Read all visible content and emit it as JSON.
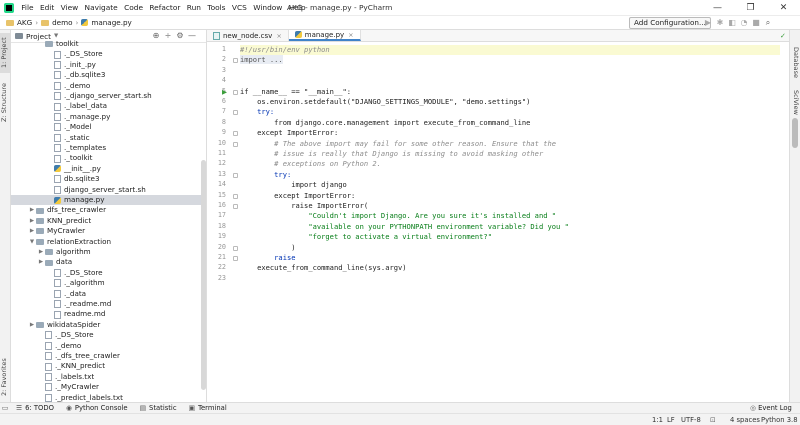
{
  "window": {
    "title": "AKG - manage.py - PyCharm",
    "menu": [
      "File",
      "Edit",
      "View",
      "Navigate",
      "Code",
      "Refactor",
      "Run",
      "Tools",
      "VCS",
      "Window",
      "Help"
    ],
    "controls": [
      "—",
      "❐",
      "✕"
    ]
  },
  "navbar": {
    "crumbs": [
      "AKG",
      "demo",
      "manage.py"
    ],
    "run_config_button": "Add Configuration..."
  },
  "left_tool_tabs": [
    "1: Project",
    "Z: Structure",
    "2: Favorites"
  ],
  "right_tool_tabs": [
    "Database",
    "SciView"
  ],
  "project": {
    "title": "Project",
    "tree": [
      {
        "label": "toolkit",
        "indent": 3,
        "kind": "folder",
        "arrow": ""
      },
      {
        "label": "._DS_Store",
        "indent": 4,
        "kind": "file",
        "arrow": ""
      },
      {
        "label": "._init_.py",
        "indent": 4,
        "kind": "file",
        "arrow": ""
      },
      {
        "label": "._db.sqlite3",
        "indent": 4,
        "kind": "file",
        "arrow": ""
      },
      {
        "label": "._demo",
        "indent": 4,
        "kind": "file",
        "arrow": ""
      },
      {
        "label": "._django_server_start.sh",
        "indent": 4,
        "kind": "file",
        "arrow": ""
      },
      {
        "label": "._label_data",
        "indent": 4,
        "kind": "file",
        "arrow": ""
      },
      {
        "label": "._manage.py",
        "indent": 4,
        "kind": "file",
        "arrow": ""
      },
      {
        "label": "._Model",
        "indent": 4,
        "kind": "file",
        "arrow": ""
      },
      {
        "label": "._static",
        "indent": 4,
        "kind": "file",
        "arrow": ""
      },
      {
        "label": "._templates",
        "indent": 4,
        "kind": "file",
        "arrow": ""
      },
      {
        "label": "._toolkit",
        "indent": 4,
        "kind": "file",
        "arrow": ""
      },
      {
        "label": "__init__.py",
        "indent": 4,
        "kind": "py",
        "arrow": ""
      },
      {
        "label": "db.sqlite3",
        "indent": 4,
        "kind": "file",
        "arrow": ""
      },
      {
        "label": "django_server_start.sh",
        "indent": 4,
        "kind": "file",
        "arrow": ""
      },
      {
        "label": "manage.py",
        "indent": 4,
        "kind": "py",
        "arrow": "",
        "selected": true
      },
      {
        "label": "dfs_tree_crawler",
        "indent": 2,
        "kind": "folder",
        "arrow": "▶"
      },
      {
        "label": "KNN_predict",
        "indent": 2,
        "kind": "folder",
        "arrow": "▶"
      },
      {
        "label": "MyCrawler",
        "indent": 2,
        "kind": "folder",
        "arrow": "▶"
      },
      {
        "label": "relationExtraction",
        "indent": 2,
        "kind": "folder",
        "arrow": "▼"
      },
      {
        "label": "algorithm",
        "indent": 3,
        "kind": "folder",
        "arrow": "▶"
      },
      {
        "label": "data",
        "indent": 3,
        "kind": "folder",
        "arrow": "▶"
      },
      {
        "label": "._DS_Store",
        "indent": 4,
        "kind": "file",
        "arrow": ""
      },
      {
        "label": "._algorithm",
        "indent": 4,
        "kind": "file",
        "arrow": ""
      },
      {
        "label": "._data",
        "indent": 4,
        "kind": "file",
        "arrow": ""
      },
      {
        "label": "._readme.md",
        "indent": 4,
        "kind": "file",
        "arrow": ""
      },
      {
        "label": "readme.md",
        "indent": 4,
        "kind": "file",
        "arrow": ""
      },
      {
        "label": "wikidataSpider",
        "indent": 2,
        "kind": "folder",
        "arrow": "▶"
      },
      {
        "label": "._DS_Store",
        "indent": 3,
        "kind": "file",
        "arrow": ""
      },
      {
        "label": "._demo",
        "indent": 3,
        "kind": "file",
        "arrow": ""
      },
      {
        "label": "._dfs_tree_crawler",
        "indent": 3,
        "kind": "file",
        "arrow": ""
      },
      {
        "label": "._KNN_predict",
        "indent": 3,
        "kind": "file",
        "arrow": ""
      },
      {
        "label": "._labels.txt",
        "indent": 3,
        "kind": "file",
        "arrow": ""
      },
      {
        "label": "._MyCrawler",
        "indent": 3,
        "kind": "file",
        "arrow": ""
      },
      {
        "label": "._predict_labels.txt",
        "indent": 3,
        "kind": "file",
        "arrow": ""
      }
    ]
  },
  "editor": {
    "tabs": [
      {
        "label": "new_node.csv",
        "active": false
      },
      {
        "label": "manage.py",
        "active": true
      }
    ],
    "lines": [
      {
        "n": "1",
        "text": "#!/usr/bin/env python",
        "cls": "cm"
      },
      {
        "n": "2",
        "text": "import ...",
        "cls": "kw"
      },
      {
        "n": "3",
        "text": "",
        "cls": ""
      },
      {
        "n": "4",
        "text": "",
        "cls": ""
      },
      {
        "n": "5",
        "text": "if __name__ == \"__main__\":",
        "cls": ""
      },
      {
        "n": "6",
        "text": "    os.environ.setdefault(\"DJANGO_SETTINGS_MODULE\", \"demo.settings\")",
        "cls": ""
      },
      {
        "n": "7",
        "text": "    try:",
        "cls": "kw"
      },
      {
        "n": "8",
        "text": "        from django.core.management import execute_from_command_line",
        "cls": ""
      },
      {
        "n": "9",
        "text": "    except ImportError:",
        "cls": ""
      },
      {
        "n": "10",
        "text": "        # The above import may fail for some other reason. Ensure that the",
        "cls": "cm"
      },
      {
        "n": "11",
        "text": "        # issue is really that Django is missing to avoid masking other",
        "cls": "cm"
      },
      {
        "n": "12",
        "text": "        # exceptions on Python 2.",
        "cls": "cm"
      },
      {
        "n": "13",
        "text": "        try:",
        "cls": "kw"
      },
      {
        "n": "14",
        "text": "            import django",
        "cls": ""
      },
      {
        "n": "15",
        "text": "        except ImportError:",
        "cls": ""
      },
      {
        "n": "16",
        "text": "            raise ImportError(",
        "cls": ""
      },
      {
        "n": "17",
        "text": "                \"Couldn't import Django. Are you sure it's installed and \"",
        "cls": "st"
      },
      {
        "n": "18",
        "text": "                \"available on your PYTHONPATH environment variable? Did you \"",
        "cls": "st"
      },
      {
        "n": "19",
        "text": "                \"forget to activate a virtual environment?\"",
        "cls": "st"
      },
      {
        "n": "20",
        "text": "            )",
        "cls": ""
      },
      {
        "n": "21",
        "text": "        raise",
        "cls": "kw"
      },
      {
        "n": "22",
        "text": "    execute_from_command_line(sys.argv)",
        "cls": ""
      },
      {
        "n": "23",
        "text": "",
        "cls": ""
      }
    ]
  },
  "bottom_tools": [
    {
      "icon": "☰",
      "label": "6: TODO"
    },
    {
      "icon": "◉",
      "label": "Python Console"
    },
    {
      "icon": "▤",
      "label": "Statistic"
    },
    {
      "icon": "▣",
      "label": "Terminal"
    }
  ],
  "event_log": "Event Log",
  "status": {
    "position": "1:1",
    "line_sep": "LF",
    "encoding": "UTF-8",
    "indent": "4 spaces",
    "interpreter": "Python 3.8"
  }
}
